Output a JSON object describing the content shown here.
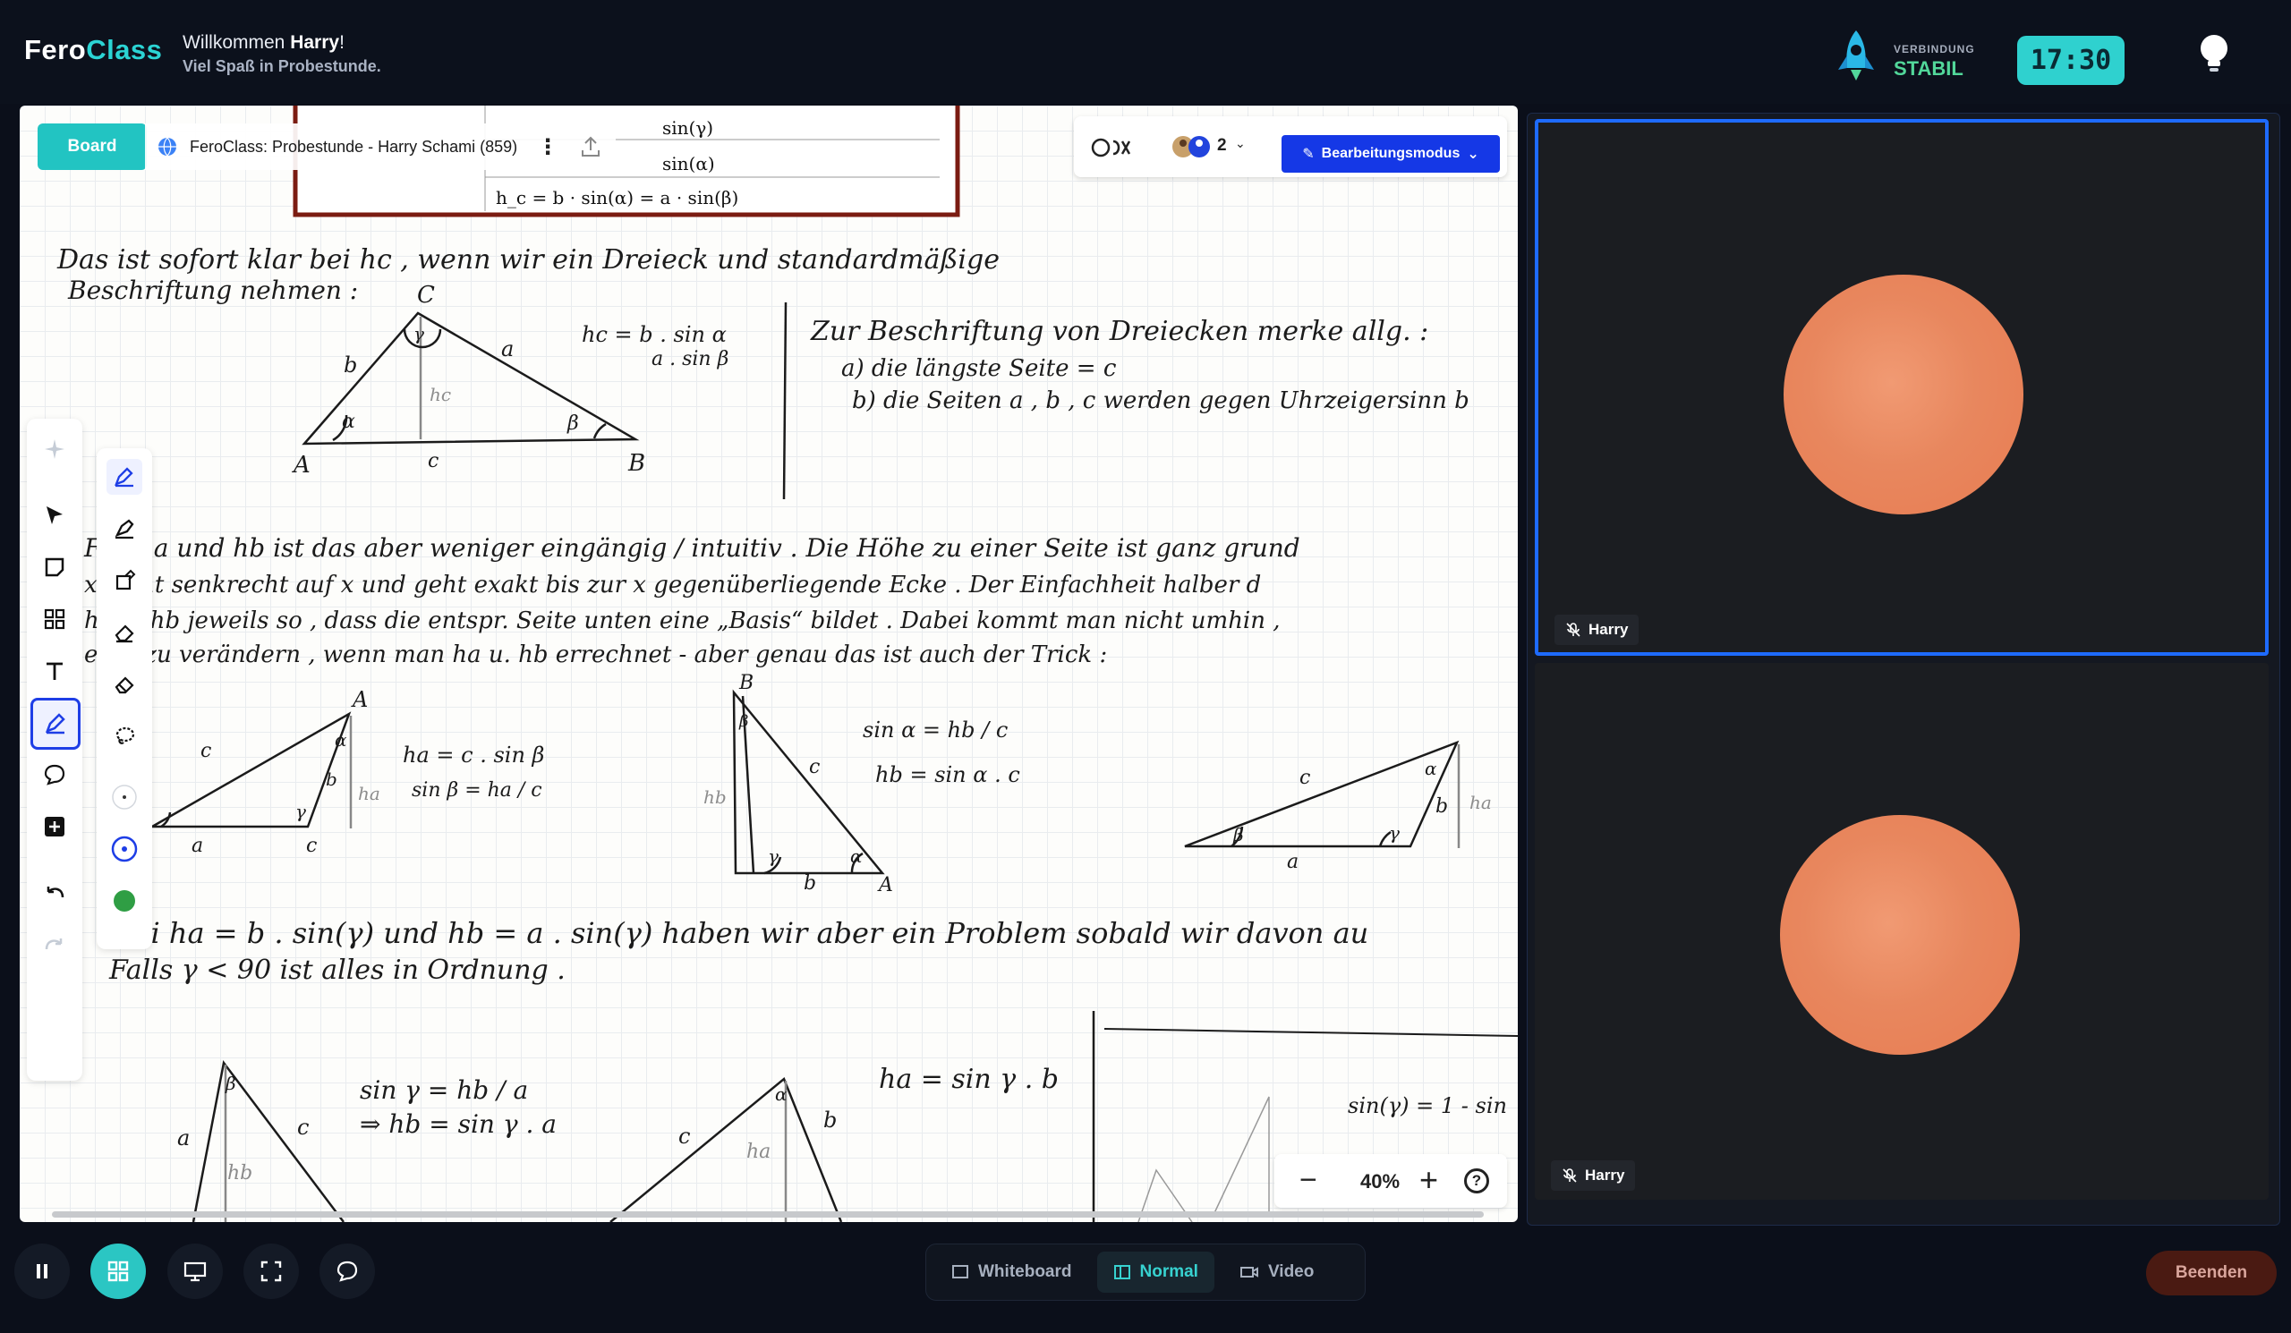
{
  "header": {
    "logo_a": "Fero",
    "logo_b": "Class",
    "welcome_prefix": "Willkommen ",
    "welcome_name": "Harry",
    "welcome_suffix": "!",
    "subtitle": "Viel Spaß in Probestunde.",
    "connection_label": "VERBINDUNG",
    "connection_status": "STABIL",
    "timer": "17:30"
  },
  "board": {
    "chip": "Board",
    "title": "FeroClass: Probestunde - Harry Schami (859)",
    "participants_count": "2",
    "mode_button": "Bearbeitungsmodus",
    "zoom": "40%",
    "zoom_minus": "−",
    "zoom_plus": "+",
    "help": "?",
    "formula_box": [
      "sin(γ)",
      "sin(α)",
      "h_c = b · sin(α) = a · sin(β)"
    ],
    "notes": [
      "Das ist sofort klar bei hc , wenn wir ein Dreieck und standardmäßige",
      "Beschriftung nehmen :",
      "hc = b . sin α",
      "a . sin β",
      "Zur Beschriftung von Dreiecken merke allg. :",
      "a) die längste Seite = c",
      "b) die Seiten a , b , c werden gegen Uhrzeigersinn b",
      "Für ha und hb ist das aber weniger eingängig / intuitiv . Die Höhe zu einer Seite ist ganz grund",
      "x steht senkrecht auf x und geht exakt bis zur x gegenüberliegende Ecke . Der Einfachheit halber d",
      "ha u. hb jeweils so , dass die entspr. Seite unten eine „Basis“ bildet . Dabei kommt man nicht umhin ,",
      "ecks zu verändern , wenn man ha u. hb errechnet - aber genau das ist auch der Trick :",
      "ha = c . sin β",
      "sin β = ha / c",
      "sin α = hb / c",
      "hb = sin α . c",
      "Bei ha = b . sin(γ) und hb = a . sin(γ) haben wir aber ein Problem sobald wir davon au",
      "Falls γ < 90 ist alles in Ordnung .",
      "sin γ = hb / a",
      "⇒ hb = sin γ . a",
      "ha = sin γ . b",
      "sin(γ) = 1 - sin"
    ],
    "labels": {
      "A": "A",
      "B": "B",
      "C": "C",
      "a": "a",
      "b": "b",
      "c": "c",
      "ha": "ha",
      "hb": "hb",
      "hc": "hc",
      "alpha": "α",
      "beta": "β",
      "gamma": "γ"
    }
  },
  "videos": [
    {
      "name": "Harry",
      "avatar_color": "#e8875e"
    },
    {
      "name": "Harry",
      "avatar_color": "#e8875e"
    }
  ],
  "bottom": {
    "modes": [
      "Whiteboard",
      "Normal",
      "Video"
    ],
    "selected_mode": "Normal",
    "end_button": "Beenden"
  },
  "colors": {
    "accent": "#2bd4d4",
    "primary_blue": "#1538e6",
    "status_green": "#52d79a",
    "end_button_bg": "#4a1a12"
  }
}
